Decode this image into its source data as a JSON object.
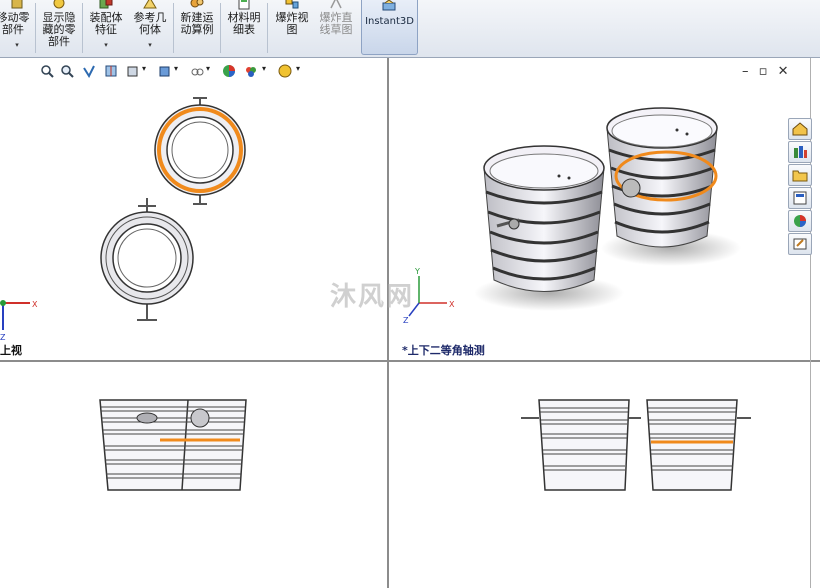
{
  "toolbar": {
    "buttons": [
      {
        "label": "移动零\n部件",
        "icon": "move-component-icon",
        "dropdown": "▾",
        "disabled": false
      },
      {
        "label": "显示隐\n藏的零\n部件",
        "icon": "show-hidden-icon",
        "dropdown": "",
        "disabled": false
      },
      {
        "label": "装配体\n特征",
        "icon": "assembly-feature-icon",
        "dropdown": "▾",
        "disabled": false
      },
      {
        "label": "参考几\n何体",
        "icon": "reference-geometry-icon",
        "dropdown": "▾",
        "disabled": false
      },
      {
        "label": "新建运\n动算例",
        "icon": "motion-study-icon",
        "dropdown": "",
        "disabled": false
      },
      {
        "label": "材料明\n细表",
        "icon": "bom-icon",
        "dropdown": "",
        "disabled": false
      },
      {
        "label": "爆炸视\n图",
        "icon": "exploded-view-icon",
        "dropdown": "",
        "disabled": false
      },
      {
        "label": "爆炸直\n线草图",
        "icon": "explode-line-sketch-icon",
        "dropdown": "",
        "disabled": true
      }
    ],
    "instant3d": {
      "label": "Instant3D",
      "icon": "instant3d-icon"
    }
  },
  "viewports": {
    "top_left_label": "上视",
    "top_right_label": "*上下二等角轴测"
  },
  "window_controls": {
    "minimize": "–",
    "restore": "▫",
    "close": "✕"
  },
  "watermark": {
    "text": "沐风网"
  },
  "colors": {
    "highlight": "#f08a1c",
    "toolbar_bg": "#e6ebf2",
    "split_line": "#8c8c8c"
  }
}
